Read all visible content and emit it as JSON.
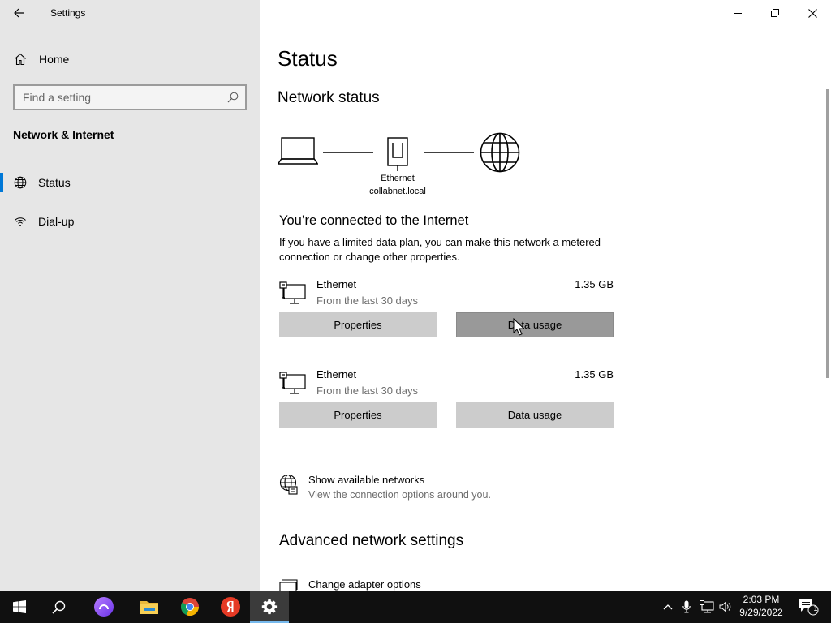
{
  "window": {
    "app_title": "Settings",
    "controls": [
      "minimize-icon",
      "restore-icon",
      "close-icon"
    ]
  },
  "sidebar": {
    "home_label": "Home",
    "search_placeholder": "Find a setting",
    "section_title": "Network & Internet",
    "items": [
      {
        "label": "Status",
        "icon": "status-globe-icon",
        "selected": true
      },
      {
        "label": "Dial-up",
        "icon": "dialup-icon",
        "selected": false
      }
    ]
  },
  "main": {
    "page_title": "Status",
    "network_status_heading": "Network status",
    "diagram": {
      "adapter_name": "Ethernet",
      "domain": "collabnet.local"
    },
    "connected_heading": "You’re connected to the Internet",
    "connected_description": "If you have a limited data plan, you can make this network a metered connection or change other properties.",
    "adapters": [
      {
        "name": "Ethernet",
        "period": "From the last 30 days",
        "usage": "1.35 GB",
        "properties_label": "Properties",
        "data_usage_label": "Data usage"
      },
      {
        "name": "Ethernet",
        "period": "From the last 30 days",
        "usage": "1.35 GB",
        "properties_label": "Properties",
        "data_usage_label": "Data usage"
      }
    ],
    "show_networks": {
      "title": "Show available networks",
      "subtitle": "View the connection options around you."
    },
    "advanced_heading": "Advanced network settings",
    "change_adapter_label": "Change adapter options"
  },
  "taskbar": {
    "apps": [
      "windows-start-icon",
      "search-icon",
      "alice-icon",
      "file-explorer-icon",
      "chrome-icon",
      "yandex-icon",
      "settings-gear-icon"
    ],
    "tray": [
      "chevron-up-icon",
      "microphone-icon",
      "network-icon",
      "volume-icon"
    ],
    "time": "2:03 PM",
    "date": "9/29/2022",
    "notification_count": "1",
    "accent_color": "#0078d7"
  }
}
